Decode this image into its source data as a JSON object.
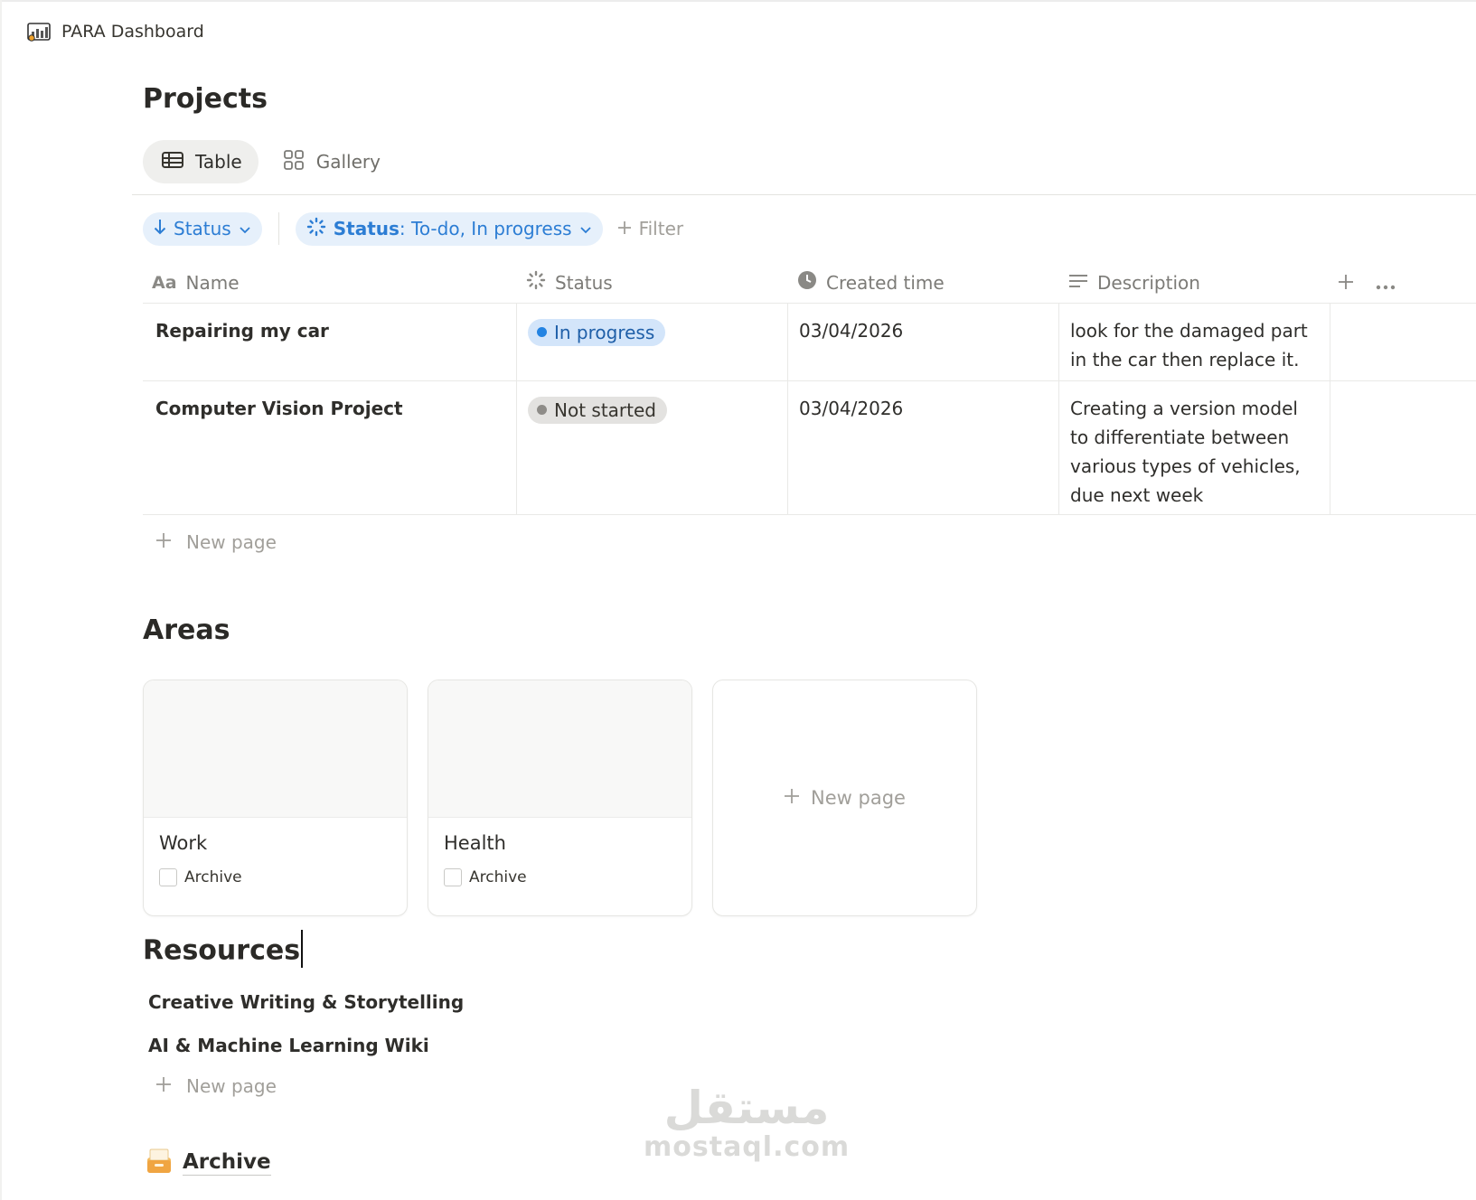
{
  "topbar": {
    "title": "PARA Dashboard",
    "icon": "chart-icon"
  },
  "projects": {
    "heading": "Projects",
    "tabs": [
      {
        "label": "Table",
        "icon": "table-icon",
        "active": true
      },
      {
        "label": "Gallery",
        "icon": "gallery-icon",
        "active": false
      }
    ],
    "sort_chip": {
      "label": "Status"
    },
    "filter_chip": {
      "prefix": "Status",
      "value": ": To-do, In progress"
    },
    "filter_add": "Filter",
    "columns": [
      {
        "label": "Name",
        "icon": "text-icon"
      },
      {
        "label": "Status",
        "icon": "status-icon"
      },
      {
        "label": "Created time",
        "icon": "clock-icon"
      },
      {
        "label": "Description",
        "icon": "lines-icon"
      }
    ],
    "rows": [
      {
        "name": "Repairing my car",
        "status": "In progress",
        "created": "03/04/2026",
        "description": "look for the damaged part in the car then replace it."
      },
      {
        "name": "Computer Vision Project",
        "status": "Not started",
        "created": "03/04/2026",
        "description": "Creating a version model to differentiate between various types of vehicles, due next week"
      }
    ],
    "new_page": "New page"
  },
  "areas": {
    "heading": "Areas",
    "cards": [
      {
        "title": "Work",
        "property": "Archive",
        "checked": false
      },
      {
        "title": "Health",
        "property": "Archive",
        "checked": false
      }
    ],
    "new_page": "New page"
  },
  "resources": {
    "heading": "Resources",
    "items": [
      "Creative Writing & Storytelling",
      "AI & Machine Learning Wiki"
    ],
    "new_page": "New page"
  },
  "archive": {
    "label": "Archive",
    "icon": "archive-box-icon"
  },
  "watermark": {
    "arabic": "مستقل",
    "latin": "mostaql.com"
  },
  "colors": {
    "accent_blue": "#2c7dd4",
    "chip_bg": "#e6f0fb",
    "in_progress_bg": "#d3e5fa",
    "in_progress_dot": "#2383e2",
    "not_started_bg": "#e3e2e0",
    "not_started_dot": "#8e8c88"
  }
}
